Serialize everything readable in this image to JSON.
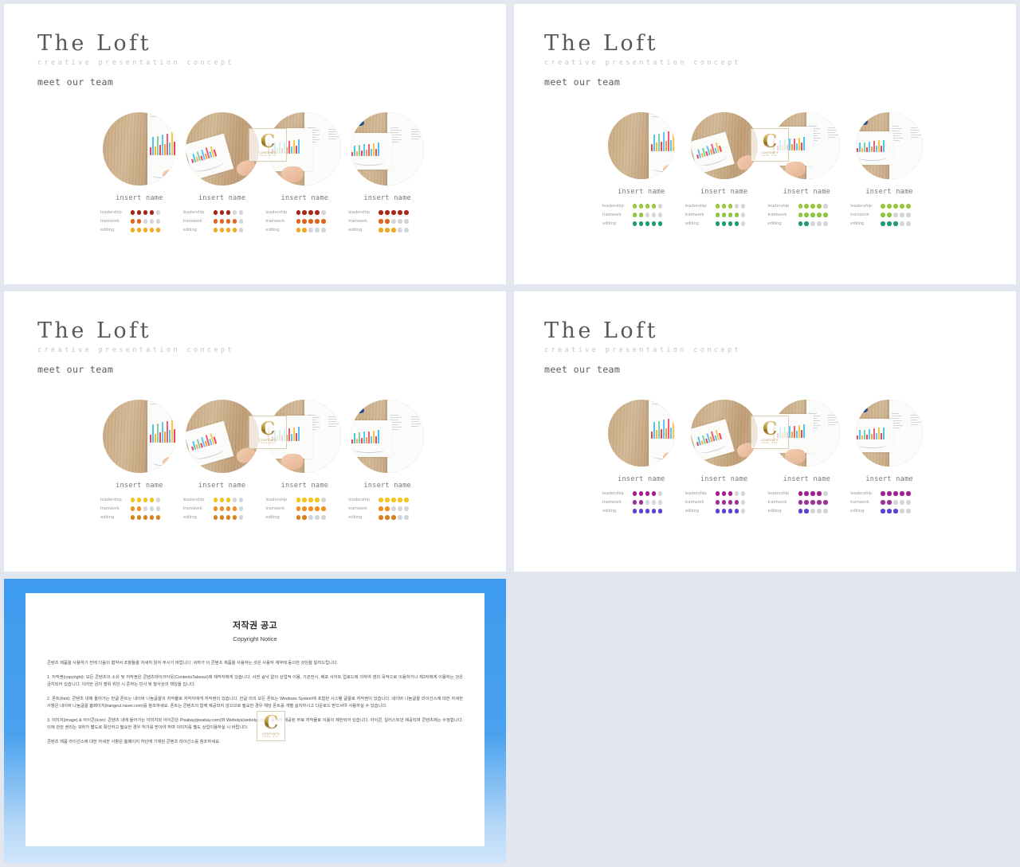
{
  "workspace": {
    "background_color": "#e2e7ef",
    "gutter_color": "#dfe4ed"
  },
  "slides": [
    {
      "id": "slide-1",
      "title": "The Loft",
      "subtitle": "creative presentation concept",
      "lead": "meet our team",
      "accent_primary": "#a62a18",
      "accent_secondary": "#e0641e",
      "accent_tertiary": "#f0a81f",
      "empty_dot_color": "#d3d5da",
      "members": [
        {
          "name": "insert name",
          "skills": [
            {
              "label": "leadership",
              "filled": 4,
              "total": 5,
              "color": "#a62a18"
            },
            {
              "label": "tramwork",
              "filled": 2,
              "total": 5,
              "color": "#e0641e"
            },
            {
              "label": "editing",
              "filled": 5,
              "total": 5,
              "color": "#f0a81f"
            }
          ]
        },
        {
          "name": "insert name",
          "skills": [
            {
              "label": "leadership",
              "filled": 3,
              "total": 5,
              "color": "#a62a18"
            },
            {
              "label": "tramwork",
              "filled": 4,
              "total": 5,
              "color": "#e0641e"
            },
            {
              "label": "editing",
              "filled": 4,
              "total": 5,
              "color": "#f0a81f"
            }
          ]
        },
        {
          "name": "insert name",
          "skills": [
            {
              "label": "leadership",
              "filled": 4,
              "total": 5,
              "color": "#a62a18"
            },
            {
              "label": "tramwork",
              "filled": 5,
              "total": 5,
              "color": "#e0641e"
            },
            {
              "label": "editing",
              "filled": 2,
              "total": 5,
              "color": "#f0a81f"
            }
          ]
        },
        {
          "name": "insert name",
          "skills": [
            {
              "label": "leadership",
              "filled": 5,
              "total": 5,
              "color": "#a62a18"
            },
            {
              "label": "tramwork",
              "filled": 2,
              "total": 5,
              "color": "#e0641e"
            },
            {
              "label": "editing",
              "filled": 3,
              "total": 5,
              "color": "#f0a81f"
            }
          ]
        }
      ]
    },
    {
      "id": "slide-2",
      "title": "The Loft",
      "subtitle": "creative presentation concept",
      "lead": "meet our team",
      "accent_primary": "#9ac73f",
      "accent_secondary": "#8cc63f",
      "accent_tertiary": "#1f9d6e",
      "empty_dot_color": "#d3d5da",
      "members": [
        {
          "name": "insert name",
          "skills": [
            {
              "label": "leadership",
              "filled": 4,
              "total": 5,
              "color": "#9ac73f"
            },
            {
              "label": "tramwork",
              "filled": 2,
              "total": 5,
              "color": "#8cc63f"
            },
            {
              "label": "editing",
              "filled": 5,
              "total": 5,
              "color": "#1f9d6e"
            }
          ]
        },
        {
          "name": "insert name",
          "skills": [
            {
              "label": "leadership",
              "filled": 3,
              "total": 5,
              "color": "#9ac73f"
            },
            {
              "label": "tramwork",
              "filled": 4,
              "total": 5,
              "color": "#8cc63f"
            },
            {
              "label": "editing",
              "filled": 4,
              "total": 5,
              "color": "#1f9d6e"
            }
          ]
        },
        {
          "name": "insert name",
          "skills": [
            {
              "label": "leadership",
              "filled": 4,
              "total": 5,
              "color": "#9ac73f"
            },
            {
              "label": "tramwork",
              "filled": 5,
              "total": 5,
              "color": "#8cc63f"
            },
            {
              "label": "editing",
              "filled": 2,
              "total": 5,
              "color": "#1f9d6e"
            }
          ]
        },
        {
          "name": "insert name",
          "skills": [
            {
              "label": "leadership",
              "filled": 5,
              "total": 5,
              "color": "#9ac73f"
            },
            {
              "label": "tramwork",
              "filled": 2,
              "total": 5,
              "color": "#8cc63f"
            },
            {
              "label": "editing",
              "filled": 3,
              "total": 5,
              "color": "#1f9d6e"
            }
          ]
        }
      ]
    },
    {
      "id": "slide-3",
      "title": "The Loft",
      "subtitle": "creative presentation concept",
      "lead": "meet our team",
      "accent_primary": "#f4c51c",
      "accent_secondary": "#ef8f1f",
      "accent_tertiary": "#d9801d",
      "empty_dot_color": "#d3d5da",
      "members": [
        {
          "name": "insert name",
          "skills": [
            {
              "label": "leadership",
              "filled": 4,
              "total": 5,
              "color": "#f4c51c"
            },
            {
              "label": "tramwork",
              "filled": 2,
              "total": 5,
              "color": "#ef8f1f"
            },
            {
              "label": "editing",
              "filled": 5,
              "total": 5,
              "color": "#d9801d"
            }
          ]
        },
        {
          "name": "insert name",
          "skills": [
            {
              "label": "leadership",
              "filled": 3,
              "total": 5,
              "color": "#f4c51c"
            },
            {
              "label": "tramwork",
              "filled": 4,
              "total": 5,
              "color": "#ef8f1f"
            },
            {
              "label": "editing",
              "filled": 4,
              "total": 5,
              "color": "#d9801d"
            }
          ]
        },
        {
          "name": "insert name",
          "skills": [
            {
              "label": "leadership",
              "filled": 4,
              "total": 5,
              "color": "#f4c51c"
            },
            {
              "label": "tramwork",
              "filled": 5,
              "total": 5,
              "color": "#ef8f1f"
            },
            {
              "label": "editing",
              "filled": 2,
              "total": 5,
              "color": "#d9801d"
            }
          ]
        },
        {
          "name": "insert name",
          "skills": [
            {
              "label": "leadership",
              "filled": 5,
              "total": 5,
              "color": "#f4c51c"
            },
            {
              "label": "tramwork",
              "filled": 2,
              "total": 5,
              "color": "#ef8f1f"
            },
            {
              "label": "editing",
              "filled": 3,
              "total": 5,
              "color": "#d9801d"
            }
          ]
        }
      ]
    },
    {
      "id": "slide-4",
      "title": "The Loft",
      "subtitle": "creative presentation concept",
      "lead": "meet our team",
      "accent_primary": "#a51d8f",
      "accent_secondary": "#9c2f9c",
      "accent_tertiary": "#5b3fd4",
      "empty_dot_color": "#d3d5da",
      "members": [
        {
          "name": "insert name",
          "skills": [
            {
              "label": "leadership",
              "filled": 4,
              "total": 5,
              "color": "#a51d8f"
            },
            {
              "label": "tramwork",
              "filled": 2,
              "total": 5,
              "color": "#9c2f9c"
            },
            {
              "label": "editing",
              "filled": 5,
              "total": 5,
              "color": "#5b3fd4"
            }
          ]
        },
        {
          "name": "insert name",
          "skills": [
            {
              "label": "leadership",
              "filled": 3,
              "total": 5,
              "color": "#a51d8f"
            },
            {
              "label": "tramwork",
              "filled": 4,
              "total": 5,
              "color": "#9c2f9c"
            },
            {
              "label": "editing",
              "filled": 4,
              "total": 5,
              "color": "#5b3fd4"
            }
          ]
        },
        {
          "name": "insert name",
          "skills": [
            {
              "label": "leadership",
              "filled": 4,
              "total": 5,
              "color": "#a51d8f"
            },
            {
              "label": "tramwork",
              "filled": 5,
              "total": 5,
              "color": "#9c2f9c"
            },
            {
              "label": "editing",
              "filled": 2,
              "total": 5,
              "color": "#5b3fd4"
            }
          ]
        },
        {
          "name": "insert name",
          "skills": [
            {
              "label": "leadership",
              "filled": 5,
              "total": 5,
              "color": "#a51d8f"
            },
            {
              "label": "tramwork",
              "filled": 2,
              "total": 5,
              "color": "#9c2f9c"
            },
            {
              "label": "editing",
              "filled": 3,
              "total": 5,
              "color": "#5b3fd4"
            }
          ]
        }
      ]
    }
  ],
  "watermark": {
    "letter": "C",
    "line1": "CONTENTS",
    "line2": "TAKE OUT"
  },
  "copyright_slide": {
    "border_color": "#3d9bee",
    "title_ko": "저작권 공고",
    "title_en": "Copyright Notice",
    "intro": "콘텐츠 제품을 사용하기 전에 다음의 협약서 조항들을 자세히 읽어 주시기 바랍니다. 귀하가 이 콘텐츠 제품을 사용하는 것은 사용자 계약에 동의한 것임을 알려드립니다.",
    "p1": "1. 저작권(copyright): 모든 콘텐츠의 소유 및 저작권은 콘텐츠테이크아웃(ContentsTakeout)에 제작자에게 있습니다. 사전 승낙 없이 상업적 이용, 기관전시, 배포 사이트 업로드에 의하여 영리 목적으로 이용하거나 제3자에게 이용하는 것은 금지되어 있습니다. 이러한 금지 행위 위반 시 준하는 민사 및 형사상의 책임을 집니다.",
    "p2": "2. 폰트(font): 콘텐츠 내에 들어가는 한글 폰트는 네이버 나눔글꼴의 저작물로 저작자에게 저작권이 있습니다. 한글 외의 모든 폰트는 Windows System에 포함된 시스템 글꼴로 저작권이 있습니다. 네이버 나눔글꼴 라이선스에 대한 자세한 사항은 네이버 나눔글꼴 홈페이지(hangeul.naver.com)를 참조하세요. 폰트는 콘텐츠의 함께 제공되지 않으므로 필요한 경우 해당 폰트를 개별 설치하시고 다운로드 받으셔야 사용하실 수 있습니다.",
    "p3": "3. 이미지(image) & 아이콘(icon): 콘텐츠 내에 들어가는 이미지와 아이콘은 Pixabay(pixabay.com)와 Webolys(webolys.com) 등에서 제공된 무료 저작물로 이용이 제한되어 있습니다. 아이콘, 일러스트만 제공되며 콘텐츠에는 수정합니다. 이에 관한 권리는 귀하가 별도로 확인하고 필요한 경우 허가를 받아야 하며 이미지를 별도 상업이용하실 시 바랍니다.",
    "footer": "콘텐츠 제품 라이선스에 대한 자세한 사항은 홈페이지 하단에 기재된 콘텐츠 라이선스를 참조하세요."
  }
}
